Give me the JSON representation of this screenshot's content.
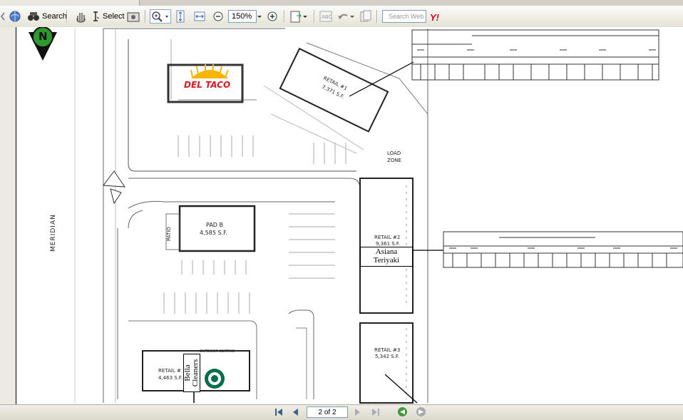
{
  "toolbar": {
    "search_label": "Search",
    "select_label": "Select",
    "zoom_value": "150%",
    "search_web_placeholder": "Search Web",
    "yahoo_label": "Y!"
  },
  "navigation": {
    "page_indicator": "2 of 2"
  },
  "map": {
    "north_letter": "N",
    "road_label": "MERIDIAN",
    "deltaco_label": "DEL TACO",
    "retail1_title": "RETAIL #1",
    "retail1_size": "7,371 S.F.",
    "load_zone_line1": "LOAD",
    "load_zone_line2": "ZONE",
    "pad_b_title": "PAD B",
    "pad_b_size": "4,585 S.F.",
    "patio_label": "PATIO",
    "retail2_title": "RETAIL #2",
    "retail2_size": "9,361 S.F.",
    "retail3_title": "RETAIL #3",
    "retail3_size": "5,342 S.F.",
    "retail4_title": "RETAIL #",
    "retail4_size": "4,463 S.F.",
    "outdoor_seating": "OUTDOOR SEATING",
    "asiana_line1": "Asiana",
    "asiana_line2": "Teriyaki",
    "bella_line1": "Bella",
    "bella_line2": "Cleaners"
  },
  "colors": {
    "deltaco_red": "#d71920",
    "deltaco_yellow": "#f7b500",
    "starbucks_green": "#00704a",
    "north_green": "#2e9a2e"
  }
}
